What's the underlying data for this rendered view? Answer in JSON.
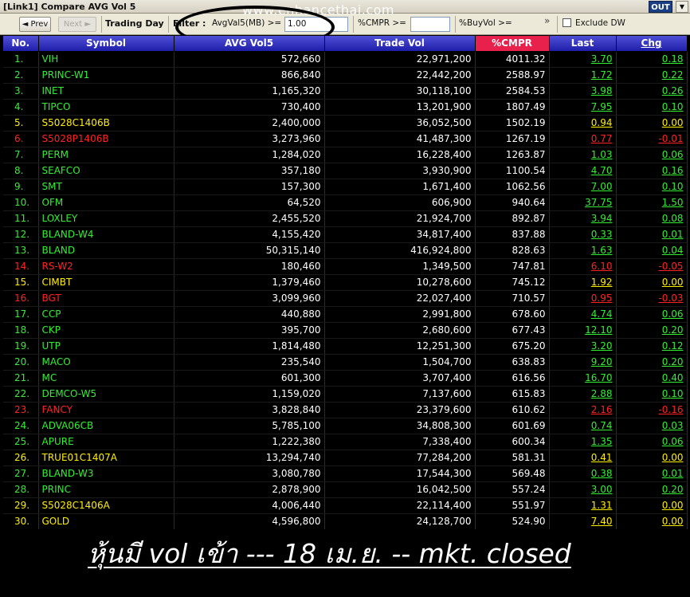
{
  "window": {
    "title": "[Link1] Compare AVG Vol 5",
    "close_label": "OUT",
    "dropdown_glyph": "▼"
  },
  "toolbar": {
    "prev_label": "◄ Prev",
    "next_label": "Next ►",
    "trading_day_label": "Trading Day",
    "filter_label": "Filter :",
    "avg_label": "AvgVal5(MB) >=",
    "avg_value": "1.00",
    "cmpr_label": "%CMPR >=",
    "cmpr_value": "",
    "buyvol_label": "%BuyVol >=",
    "expand_glyph": "»",
    "exclude_label": "Exclude DW"
  },
  "watermark": "www.enhancethai.com",
  "table": {
    "headers": [
      "No.",
      "Symbol",
      "AVG Vol5",
      "Trade Vol",
      "%CMPR",
      "Last",
      "Chg"
    ],
    "rows": [
      {
        "no": "1.",
        "symbol": "VIH",
        "avg": "572,660",
        "trade": "22,971,200",
        "cmpr": "4011.32",
        "last": "3.70",
        "chg": "0.18",
        "color": "green"
      },
      {
        "no": "2.",
        "symbol": "PRINC-W1",
        "avg": "866,840",
        "trade": "22,442,200",
        "cmpr": "2588.97",
        "last": "1.72",
        "chg": "0.22",
        "color": "green"
      },
      {
        "no": "3.",
        "symbol": "INET",
        "avg": "1,165,320",
        "trade": "30,118,100",
        "cmpr": "2584.53",
        "last": "3.98",
        "chg": "0.26",
        "color": "green"
      },
      {
        "no": "4.",
        "symbol": "TIPCO",
        "avg": "730,400",
        "trade": "13,201,900",
        "cmpr": "1807.49",
        "last": "7.95",
        "chg": "0.10",
        "color": "green"
      },
      {
        "no": "5.",
        "symbol": "S5028C1406B",
        "avg": "2,400,000",
        "trade": "36,052,500",
        "cmpr": "1502.19",
        "last": "0.94",
        "chg": "0.00",
        "color": "yellow"
      },
      {
        "no": "6.",
        "symbol": "S5028P1406B",
        "avg": "3,273,960",
        "trade": "41,487,300",
        "cmpr": "1267.19",
        "last": "0.77",
        "chg": "-0.01",
        "color": "red"
      },
      {
        "no": "7.",
        "symbol": "PERM",
        "avg": "1,284,020",
        "trade": "16,228,400",
        "cmpr": "1263.87",
        "last": "1.03",
        "chg": "0.06",
        "color": "green"
      },
      {
        "no": "8.",
        "symbol": "SEAFCO",
        "avg": "357,180",
        "trade": "3,930,900",
        "cmpr": "1100.54",
        "last": "4.70",
        "chg": "0.16",
        "color": "green"
      },
      {
        "no": "9.",
        "symbol": "SMT",
        "avg": "157,300",
        "trade": "1,671,400",
        "cmpr": "1062.56",
        "last": "7.00",
        "chg": "0.10",
        "color": "green"
      },
      {
        "no": "10.",
        "symbol": "OFM",
        "avg": "64,520",
        "trade": "606,900",
        "cmpr": "940.64",
        "last": "37.75",
        "chg": "1.50",
        "color": "green"
      },
      {
        "no": "11.",
        "symbol": "LOXLEY",
        "avg": "2,455,520",
        "trade": "21,924,700",
        "cmpr": "892.87",
        "last": "3.94",
        "chg": "0.08",
        "color": "green"
      },
      {
        "no": "12.",
        "symbol": "BLAND-W4",
        "avg": "4,155,420",
        "trade": "34,817,400",
        "cmpr": "837.88",
        "last": "0.33",
        "chg": "0.01",
        "color": "green"
      },
      {
        "no": "13.",
        "symbol": "BLAND",
        "avg": "50,315,140",
        "trade": "416,924,800",
        "cmpr": "828.63",
        "last": "1.63",
        "chg": "0.04",
        "color": "green"
      },
      {
        "no": "14.",
        "symbol": "RS-W2",
        "avg": "180,460",
        "trade": "1,349,500",
        "cmpr": "747.81",
        "last": "6.10",
        "chg": "-0.05",
        "color": "red"
      },
      {
        "no": "15.",
        "symbol": "CIMBT",
        "avg": "1,379,460",
        "trade": "10,278,600",
        "cmpr": "745.12",
        "last": "1.92",
        "chg": "0.00",
        "color": "yellow"
      },
      {
        "no": "16.",
        "symbol": "BGT",
        "avg": "3,099,960",
        "trade": "22,027,400",
        "cmpr": "710.57",
        "last": "0.95",
        "chg": "-0.03",
        "color": "red"
      },
      {
        "no": "17.",
        "symbol": "CCP",
        "avg": "440,880",
        "trade": "2,991,800",
        "cmpr": "678.60",
        "last": "4.74",
        "chg": "0.06",
        "color": "green"
      },
      {
        "no": "18.",
        "symbol": "CKP",
        "avg": "395,700",
        "trade": "2,680,600",
        "cmpr": "677.43",
        "last": "12.10",
        "chg": "0.20",
        "color": "green"
      },
      {
        "no": "19.",
        "symbol": "UTP",
        "avg": "1,814,480",
        "trade": "12,251,300",
        "cmpr": "675.20",
        "last": "3.20",
        "chg": "0.12",
        "color": "green"
      },
      {
        "no": "20.",
        "symbol": "MACO",
        "avg": "235,540",
        "trade": "1,504,700",
        "cmpr": "638.83",
        "last": "9.20",
        "chg": "0.20",
        "color": "green"
      },
      {
        "no": "21.",
        "symbol": "MC",
        "avg": "601,300",
        "trade": "3,707,400",
        "cmpr": "616.56",
        "last": "16.70",
        "chg": "0.40",
        "color": "green"
      },
      {
        "no": "22.",
        "symbol": "DEMCO-W5",
        "avg": "1,159,020",
        "trade": "7,137,600",
        "cmpr": "615.83",
        "last": "2.88",
        "chg": "0.10",
        "color": "green"
      },
      {
        "no": "23.",
        "symbol": "FANCY",
        "avg": "3,828,840",
        "trade": "23,379,600",
        "cmpr": "610.62",
        "last": "2.16",
        "chg": "-0.16",
        "color": "red"
      },
      {
        "no": "24.",
        "symbol": "ADVA06CB",
        "avg": "5,785,100",
        "trade": "34,808,300",
        "cmpr": "601.69",
        "last": "0.74",
        "chg": "0.03",
        "color": "green"
      },
      {
        "no": "25.",
        "symbol": "APURE",
        "avg": "1,222,380",
        "trade": "7,338,400",
        "cmpr": "600.34",
        "last": "1.35",
        "chg": "0.06",
        "color": "green"
      },
      {
        "no": "26.",
        "symbol": "TRUE01C1407A",
        "avg": "13,294,740",
        "trade": "77,284,200",
        "cmpr": "581.31",
        "last": "0.41",
        "chg": "0.00",
        "color": "yellow"
      },
      {
        "no": "27.",
        "symbol": "BLAND-W3",
        "avg": "3,080,780",
        "trade": "17,544,300",
        "cmpr": "569.48",
        "last": "0.38",
        "chg": "0.01",
        "color": "green"
      },
      {
        "no": "28.",
        "symbol": "PRINC",
        "avg": "2,878,900",
        "trade": "16,042,500",
        "cmpr": "557.24",
        "last": "3.00",
        "chg": "0.20",
        "color": "green"
      },
      {
        "no": "29.",
        "symbol": "S5028C1406A",
        "avg": "4,006,440",
        "trade": "22,114,400",
        "cmpr": "551.97",
        "last": "1.31",
        "chg": "0.00",
        "color": "yellow"
      },
      {
        "no": "30.",
        "symbol": "GOLD",
        "avg": "4,596,800",
        "trade": "24,128,700",
        "cmpr": "524.90",
        "last": "7.40",
        "chg": "0.00",
        "color": "yellow"
      }
    ]
  },
  "caption": "หุ้นมี vol เข้า --- 18 เม.ย. -- mkt. closed",
  "colors": {
    "green": "#33ee33",
    "yellow": "#ffee00",
    "red": "#ff2222",
    "header_bg": "#2a2ab8",
    "cmpr_header_bg": "#e8204c"
  }
}
